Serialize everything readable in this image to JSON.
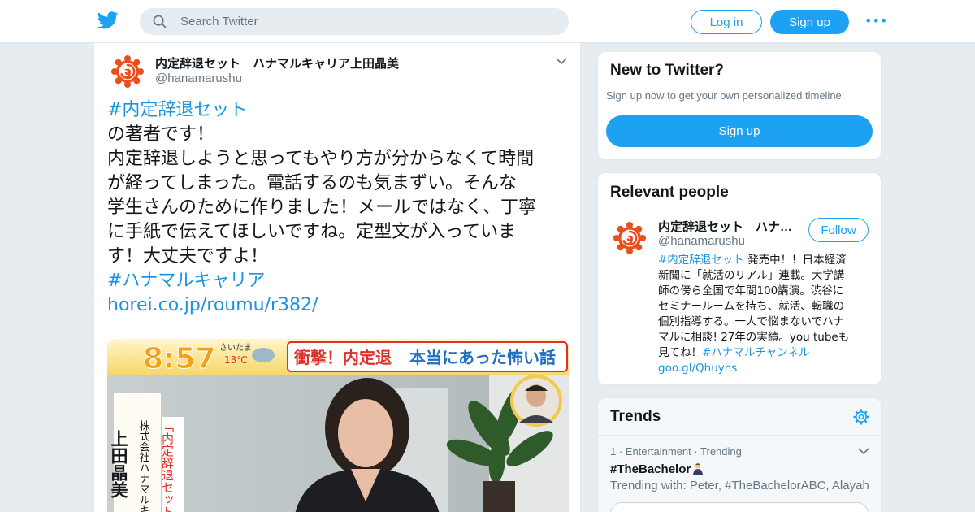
{
  "header": {
    "search_placeholder": "Search Twitter",
    "login_label": "Log in",
    "signup_label": "Sign up",
    "more_label": "•••",
    "accent_color": "#1da1f2"
  },
  "tweet": {
    "author_name": "内定辞退セット　ハナマルキャリア上田晶美",
    "author_handle": "@hanamarushu",
    "hashtag1": "#内定辞退セット",
    "lines": [
      "の著者です！",
      "内定辞退しようと思ってもやり方が分からなくて時間",
      "が経ってしまった。電話するのも気まずい。そんな",
      "学生さんのために作りました！メールではなく、丁寧",
      "に手紙で伝えてほしいですね。定型文が入っていま",
      "す！大丈夫ですよ！"
    ],
    "hashtag2": "#ハナマルキャリア",
    "url": "horei.co.jp/roumu/r382/",
    "media": {
      "time": "8:57",
      "weather_city": "さいたま",
      "weather_temp": "13℃",
      "headline_a": "衝撃！内定退",
      "headline_b": "本当にあった怖い話",
      "side_company": "株式会社ハナマルキ",
      "side_name": "上田晶美",
      "side_red": "「内定辞退セット」"
    }
  },
  "new_to_twitter": {
    "title": "New to Twitter?",
    "subtitle": "Sign up now to get your own personalized timeline!",
    "signup_label": "Sign up"
  },
  "relevant_people": {
    "title": "Relevant people",
    "name": "内定辞退セット　ハナ…",
    "handle": "@hanamarushu",
    "follow_label": "Follow",
    "bio_hashtag": "#内定辞退セット",
    "bio_lines": [
      " 発売中！！日本経済",
      "新聞に「就活のリアル」連載。大学講",
      "師の傍ら全国で年間100講演。渋谷に",
      "セミナールームを持ち、就活、転職の",
      "個別指導する。一人で悩まないでハナ",
      "マルに相談! 27年の実績。you tubeも",
      "見てね！"
    ],
    "bio_hashtag2": "#ハナマルチャンネル",
    "bio_link": "goo.gl/Qhuyhs"
  },
  "trends": {
    "title": "Trends",
    "item_meta": "1 · Entertainment · Trending",
    "item_name": "#TheBachelor",
    "item_with": "Trending with: Peter, #TheBachelorABC, Alayah"
  }
}
